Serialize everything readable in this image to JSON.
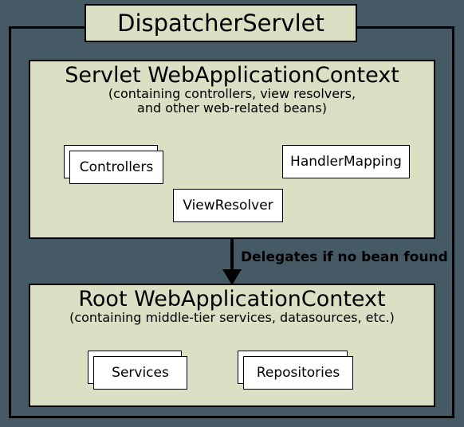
{
  "title": "DispatcherServlet",
  "servlet_context": {
    "heading": "Servlet WebApplicationContext",
    "sub_line1": "(containing controllers, view resolvers,",
    "sub_line2": "and other web-related beans)",
    "components": {
      "controllers": "Controllers",
      "view_resolver": "ViewResolver",
      "handler_mapping": "HandlerMapping"
    }
  },
  "arrow_label": "Delegates if no bean found",
  "root_context": {
    "heading": "Root WebApplicationContext",
    "sub": "(containing middle-tier services, datasources, etc.)",
    "components": {
      "services": "Services",
      "repositories": "Repositories"
    }
  }
}
